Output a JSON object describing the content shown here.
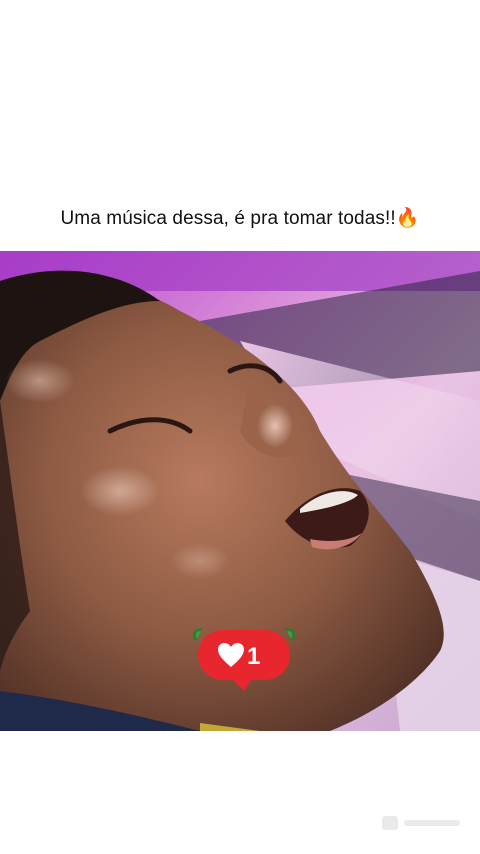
{
  "post": {
    "caption": "Uma música dessa, é pra tomar todas!!🔥"
  },
  "video": {
    "subject": "close-up of a singer with eyes closed and mouth open, sweaty face, pink and purple stage lights behind"
  },
  "like_badge": {
    "count": "1",
    "color": "#e8262e",
    "icon": "heart-icon"
  },
  "colors": {
    "background": "#ffffff",
    "stage_light": "#c84fd6"
  }
}
